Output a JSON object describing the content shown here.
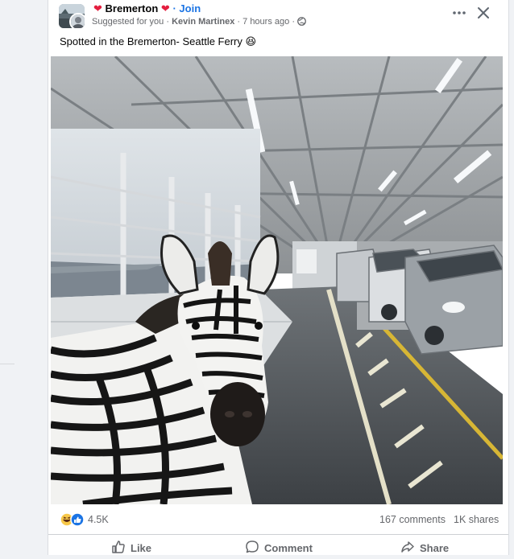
{
  "post": {
    "group_name": "Bremerton",
    "join_label": "Join",
    "suggested_label": "Suggested for you",
    "author": "Kevin Martinex",
    "time_ago": "7 hours ago",
    "caption": "Spotted in the Bremerton- Seattle Ferry 😆"
  },
  "icons": {
    "more": "more-options-icon",
    "close": "close-icon",
    "globe": "globe-icon",
    "reactions": [
      "haha-icon",
      "like-icon"
    ]
  },
  "stats": {
    "reactions": "4.5K",
    "comments": "167 comments",
    "shares": "1K shares"
  },
  "actions": {
    "like": "Like",
    "comment": "Comment",
    "share": "Share"
  },
  "colors": {
    "accent": "#1b74e4",
    "heart": "#e41e3f",
    "muted_text": "#65676b"
  }
}
